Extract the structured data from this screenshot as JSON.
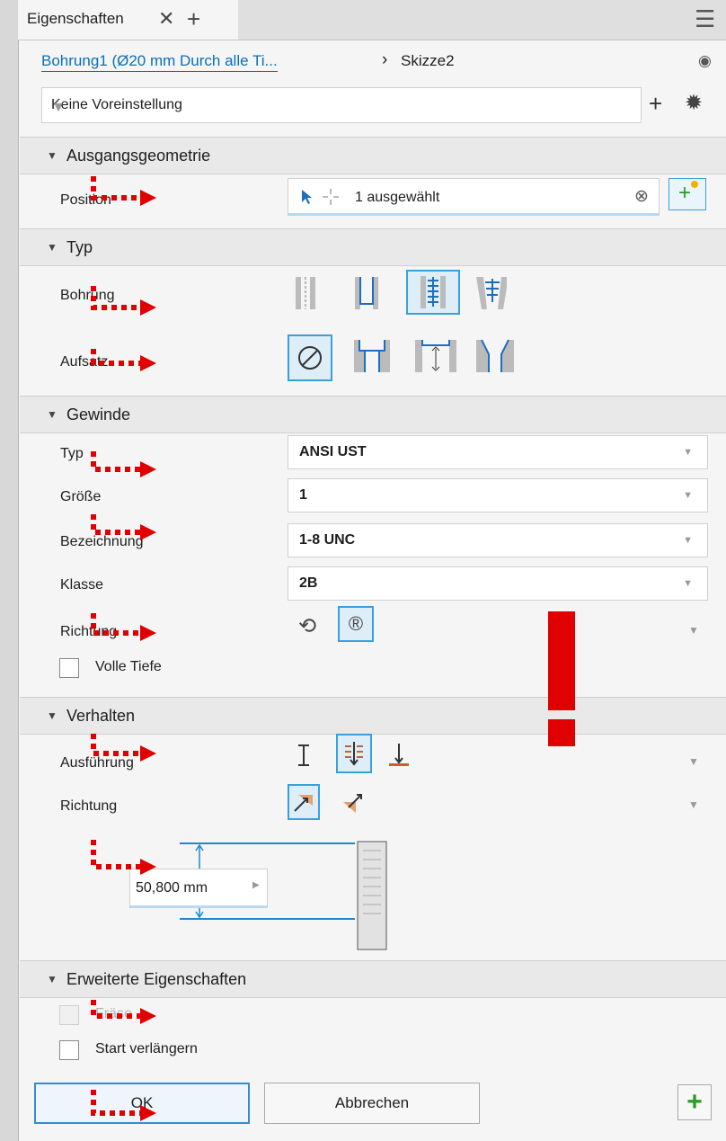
{
  "tab": {
    "title": "Eigenschaften",
    "close": "✕",
    "add": "+",
    "menu": "☰"
  },
  "breadcrumb": {
    "feature": "Bohrung1 (Ø20 mm Durch alle Ti...",
    "sep": "›",
    "sketch": "Skizze2",
    "eye": "◉"
  },
  "preset": {
    "value": "Keine Voreinstellung",
    "caret": "▼",
    "add": "+",
    "gear": "✹"
  },
  "sections": {
    "ausgang": "Ausgangsgeometrie",
    "typ": "Typ",
    "gewinde": "Gewinde",
    "verhalten": "Verhalten",
    "erweitert": "Erweiterte Eigenschaften"
  },
  "section_icon": "▼",
  "position": {
    "label": "Position",
    "value": "1 ausgewählt",
    "clear": "⊗",
    "add": "+"
  },
  "typ": {
    "bohrung": "Bohrung",
    "aufsatz": "Aufsatz"
  },
  "gewinde": {
    "typ_label": "Typ",
    "typ_value": "ANSI UST",
    "groesse_label": "Größe",
    "groesse_value": "1",
    "bez_label": "Bezeichnung",
    "bez_value": "1-8 UNC",
    "klasse_label": "Klasse",
    "klasse_value": "2B",
    "richtung_label": "Richtung",
    "volle_tiefe": "Volle Tiefe"
  },
  "verhalten": {
    "ausfuehrung": "Ausführung",
    "richtung": "Richtung",
    "depth": "50,800 mm"
  },
  "erweitert": {
    "frase": "Fräse",
    "start": "Start verlängern"
  },
  "buttons": {
    "ok": "OK",
    "cancel": "Abbrechen",
    "apply": "+"
  },
  "colors": {
    "accent": "#0b6fb8",
    "select": "#3aa0dd",
    "annotation": "#e00000",
    "apply": "#2a9a2a"
  },
  "icons": {
    "richtung_left": "⟲",
    "richtung_right": "®",
    "ausf_1": "⟂",
    "ausf_2": "≡",
    "ausf_3": "⊥"
  },
  "annotation": {
    "mark": "!"
  }
}
